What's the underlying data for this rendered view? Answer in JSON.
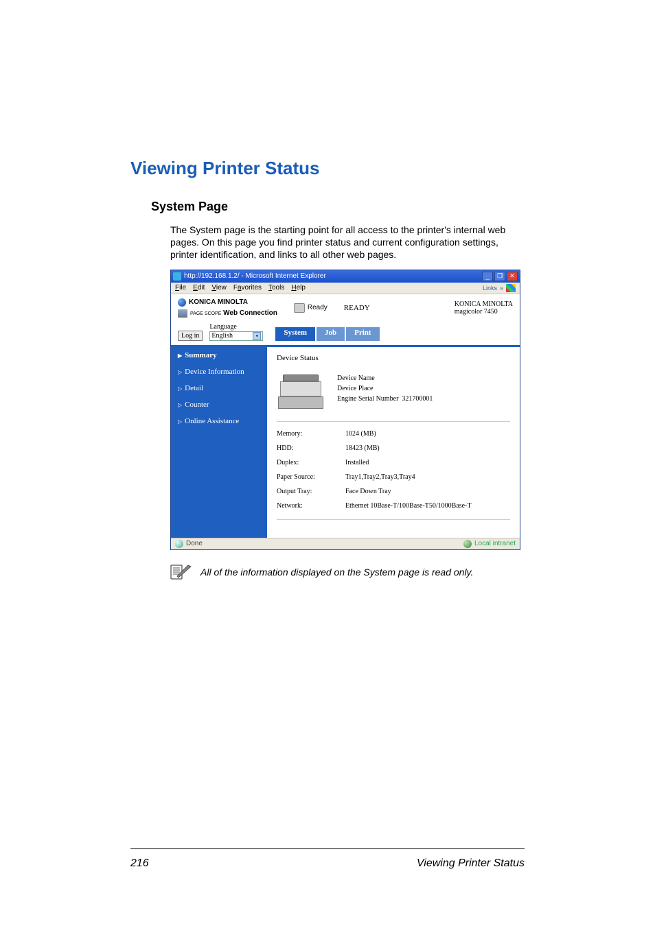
{
  "heading": "Viewing Printer Status",
  "subheading": "System Page",
  "paragraph": "The System page is the starting point for all access to the printer's internal web pages. On this page you find printer status and current configuration settings, printer identification, and links to all other web pages.",
  "browser": {
    "title": "http://192.168.1.2/ - Microsoft Internet Explorer",
    "menus": {
      "file": "File",
      "edit": "Edit",
      "view": "View",
      "favorites": "Favorites",
      "tools": "Tools",
      "help": "Help"
    },
    "links_label": "Links"
  },
  "header": {
    "brand": "KONICA MINOLTA",
    "webconn_prefix": "PAGE SCOPE",
    "webconn": "Web Connection",
    "ready_label": "Ready",
    "ready_status": "READY",
    "model_line1": "KONICA MINOLTA",
    "model_line2": "magicolor 7450"
  },
  "login": {
    "button": "Log in",
    "language_label": "Language",
    "language_value": "English"
  },
  "tabs": {
    "system": "System",
    "job": "Job",
    "print": "Print"
  },
  "sidebar": {
    "summary": "Summary",
    "device_information": "Device Information",
    "detail": "Detail",
    "counter": "Counter",
    "online_assistance": "Online Assistance"
  },
  "panel": {
    "title": "Device Status",
    "device_name_label": "Device Name",
    "device_place_label": "Device Place",
    "serial_label": "Engine Serial Number",
    "serial_value": "321700001",
    "rows": {
      "memory_label": "Memory:",
      "memory_value": "1024 (MB)",
      "hdd_label": "HDD:",
      "hdd_value": "18423 (MB)",
      "duplex_label": "Duplex:",
      "duplex_value": "Installed",
      "paper_source_label": "Paper Source:",
      "paper_source_value": "Tray1,Tray2,Tray3,Tray4",
      "output_tray_label": "Output Tray:",
      "output_tray_value": "Face Down Tray",
      "network_label": "Network:",
      "network_value": "Ethernet 10Base-T/100Base-T50/1000Base-T"
    }
  },
  "statusbar": {
    "done": "Done",
    "zone": "Local intranet"
  },
  "note": "All of the information displayed on the System page is read only.",
  "footer": {
    "page": "216",
    "title": "Viewing Printer Status"
  }
}
